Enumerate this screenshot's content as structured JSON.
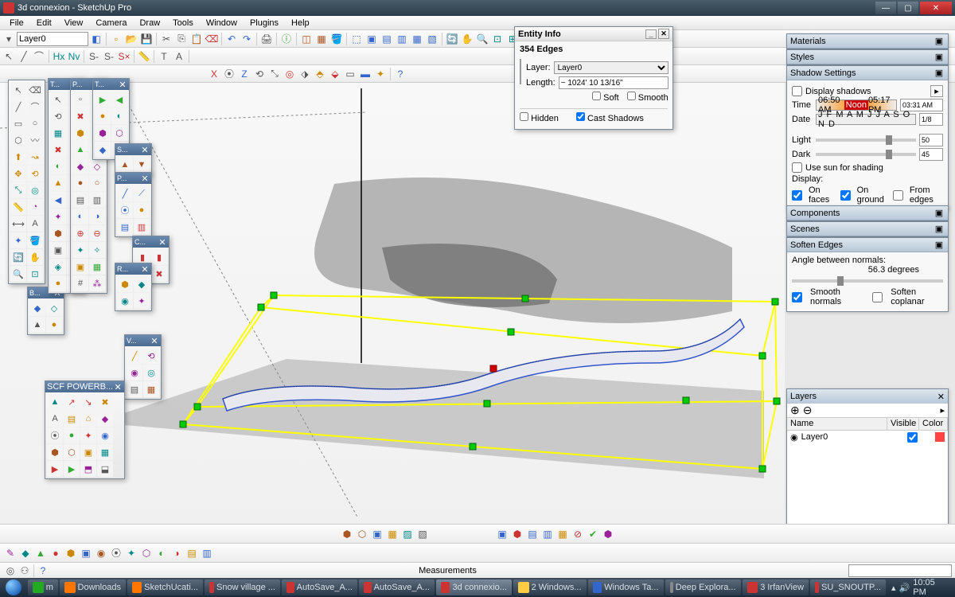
{
  "titlebar": {
    "title": "3d connexion - SketchUp Pro"
  },
  "menu": [
    "File",
    "Edit",
    "View",
    "Camera",
    "Draw",
    "Tools",
    "Window",
    "Plugins",
    "Help"
  ],
  "layer_selector": "Layer0",
  "entity_info": {
    "title": "Entity Info",
    "summary": "354 Edges",
    "layer_label": "Layer:",
    "layer_value": "Layer0",
    "length_label": "Length:",
    "length_value": "~ 1024' 10 13/16\"",
    "soft": "Soft",
    "smooth": "Smooth",
    "hidden": "Hidden",
    "cast_shadows": "Cast Shadows"
  },
  "panels": {
    "materials": "Materials",
    "styles": "Styles",
    "shadow": {
      "title": "Shadow Settings",
      "display_shadows": "Display shadows",
      "time_label": "Time",
      "time_left": "06:50 AM",
      "time_right": "05:17 PM",
      "time_value": "03:31 AM",
      "date_label": "Date",
      "date_months": "J F M A M J J A S O N D",
      "date_value": "1/8",
      "light_label": "Light",
      "light_value": "50",
      "dark_label": "Dark",
      "dark_value": "45",
      "use_sun": "Use sun for shading",
      "display": "Display:",
      "on_faces": "On faces",
      "on_ground": "On ground",
      "from_edges": "From edges"
    },
    "components": "Components",
    "scenes": "Scenes",
    "soften": {
      "title": "Soften Edges",
      "angle_label": "Angle between normals:",
      "angle_value": "56.3  degrees",
      "smooth_normals": "Smooth normals",
      "soften_coplanar": "Soften coplanar"
    }
  },
  "layers_panel": {
    "title": "Layers",
    "cols": {
      "name": "Name",
      "visible": "Visible",
      "color": "Color"
    },
    "rows": [
      {
        "name": "Layer0",
        "visible": true
      }
    ]
  },
  "palette_titles": {
    "scf": "SCF POWERB..."
  },
  "status": {
    "measurements_label": "Measurements"
  },
  "taskbar": {
    "items": [
      "m",
      "Downloads",
      "SketchUcati...",
      "Snow village ...",
      "AutoSave_A...",
      "AutoSave_A...",
      "3d connexio...",
      "2 Windows...",
      "Windows Ta...",
      "Deep Explora...",
      "3 IrfanView",
      "SU_SNOUTP..."
    ],
    "clock": "10:05 PM"
  }
}
